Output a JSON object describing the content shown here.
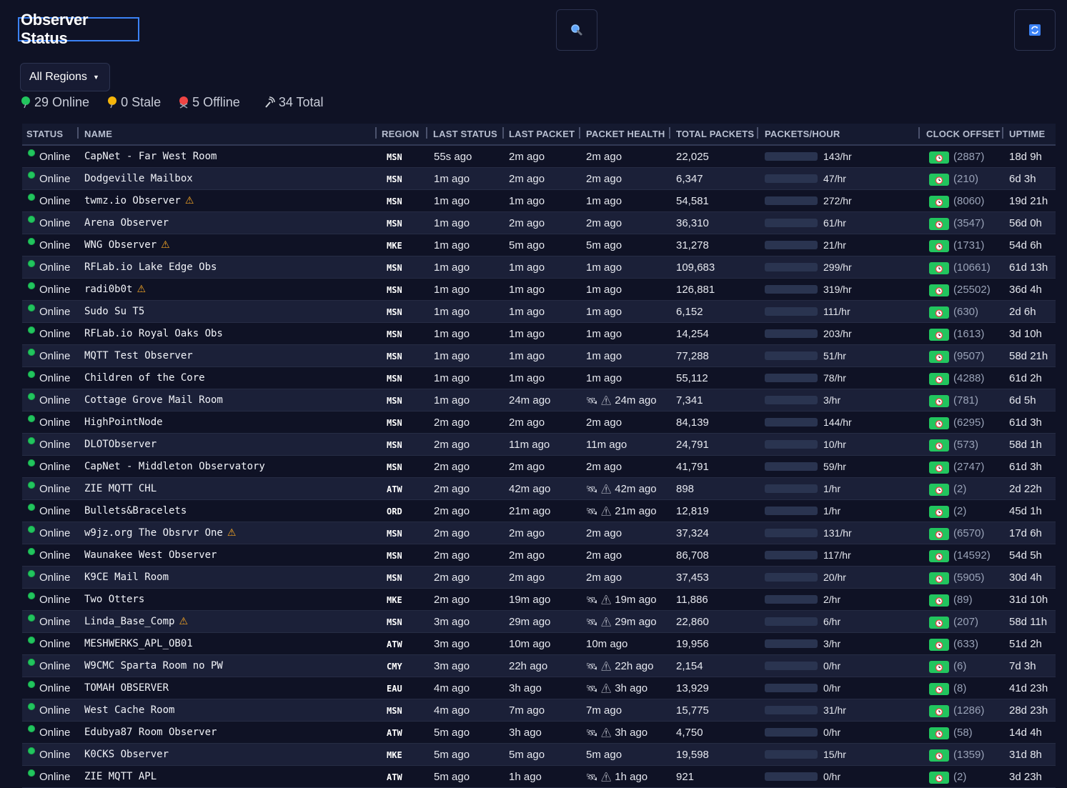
{
  "page": {
    "title": "Observer Status"
  },
  "region_filter": {
    "label": "All Regions"
  },
  "summary": {
    "online": "29 Online",
    "stale": "0 Stale",
    "offline": "5 Offline",
    "total": "34 Total"
  },
  "columns": [
    "STATUS",
    "NAME",
    "REGION",
    "LAST STATUS",
    "LAST PACKET",
    "PACKET HEALTH",
    "TOTAL PACKETS",
    "PACKETS/HOUR",
    "CLOCK OFFSET",
    "UPTIME"
  ],
  "colors": {
    "online": "#22c55e",
    "bar": "#4a8cf7",
    "warning": "#f5a524"
  },
  "rows": [
    {
      "status": "Online",
      "name": "CapNet - Far West Room",
      "warn": false,
      "region": "MSN",
      "last_status": "55s ago",
      "last_packet": "2m ago",
      "health": "2m ago",
      "health_warn": false,
      "total": "22,025",
      "pph": "143/hr",
      "pph_fraction": 0.45,
      "offset": "(2887)",
      "uptime": "18d 9h"
    },
    {
      "status": "Online",
      "name": "Dodgeville Mailbox",
      "warn": false,
      "region": "MSN",
      "last_status": "1m ago",
      "last_packet": "2m ago",
      "health": "2m ago",
      "health_warn": false,
      "total": "6,347",
      "pph": "47/hr",
      "pph_fraction": 0.15,
      "offset": "(210)",
      "uptime": "6d 3h"
    },
    {
      "status": "Online",
      "name": "twmz.io Observer",
      "warn": true,
      "region": "MSN",
      "last_status": "1m ago",
      "last_packet": "1m ago",
      "health": "1m ago",
      "health_warn": false,
      "total": "54,581",
      "pph": "272/hr",
      "pph_fraction": 0.85,
      "offset": "(8060)",
      "uptime": "19d 21h"
    },
    {
      "status": "Online",
      "name": "Arena Observer",
      "warn": false,
      "region": "MSN",
      "last_status": "1m ago",
      "last_packet": "2m ago",
      "health": "2m ago",
      "health_warn": false,
      "total": "36,310",
      "pph": "61/hr",
      "pph_fraction": 0.19,
      "offset": "(3547)",
      "uptime": "56d 0h"
    },
    {
      "status": "Online",
      "name": "WNG Observer",
      "warn": true,
      "region": "MKE",
      "last_status": "1m ago",
      "last_packet": "5m ago",
      "health": "5m ago",
      "health_warn": false,
      "total": "31,278",
      "pph": "21/hr",
      "pph_fraction": 0.07,
      "offset": "(1731)",
      "uptime": "54d 6h"
    },
    {
      "status": "Online",
      "name": "RFLab.io Lake Edge Obs",
      "warn": false,
      "region": "MSN",
      "last_status": "1m ago",
      "last_packet": "1m ago",
      "health": "1m ago",
      "health_warn": false,
      "total": "109,683",
      "pph": "299/hr",
      "pph_fraction": 0.94,
      "offset": "(10661)",
      "uptime": "61d 13h"
    },
    {
      "status": "Online",
      "name": "radi0b0t",
      "warn": true,
      "region": "MSN",
      "last_status": "1m ago",
      "last_packet": "1m ago",
      "health": "1m ago",
      "health_warn": false,
      "total": "126,881",
      "pph": "319/hr",
      "pph_fraction": 1.0,
      "offset": "(25502)",
      "uptime": "36d 4h"
    },
    {
      "status": "Online",
      "name": "Sudo Su T5",
      "warn": false,
      "region": "MSN",
      "last_status": "1m ago",
      "last_packet": "1m ago",
      "health": "1m ago",
      "health_warn": false,
      "total": "6,152",
      "pph": "111/hr",
      "pph_fraction": 0.35,
      "offset": "(630)",
      "uptime": "2d 6h"
    },
    {
      "status": "Online",
      "name": "RFLab.io Royal Oaks Obs",
      "warn": false,
      "region": "MSN",
      "last_status": "1m ago",
      "last_packet": "1m ago",
      "health": "1m ago",
      "health_warn": false,
      "total": "14,254",
      "pph": "203/hr",
      "pph_fraction": 0.64,
      "offset": "(1613)",
      "uptime": "3d 10h"
    },
    {
      "status": "Online",
      "name": "MQTT Test Observer",
      "warn": false,
      "region": "MSN",
      "last_status": "1m ago",
      "last_packet": "1m ago",
      "health": "1m ago",
      "health_warn": false,
      "total": "77,288",
      "pph": "51/hr",
      "pph_fraction": 0.16,
      "offset": "(9507)",
      "uptime": "58d 21h"
    },
    {
      "status": "Online",
      "name": "Children of the Core",
      "warn": false,
      "region": "MSN",
      "last_status": "1m ago",
      "last_packet": "1m ago",
      "health": "1m ago",
      "health_warn": false,
      "total": "55,112",
      "pph": "78/hr",
      "pph_fraction": 0.24,
      "offset": "(4288)",
      "uptime": "61d 2h"
    },
    {
      "status": "Online",
      "name": "Cottage Grove Mail Room",
      "warn": false,
      "region": "MSN",
      "last_status": "1m ago",
      "last_packet": "24m ago",
      "health": "24m ago",
      "health_warn": true,
      "total": "7,341",
      "pph": "3/hr",
      "pph_fraction": 0.01,
      "offset": "(781)",
      "uptime": "6d 5h"
    },
    {
      "status": "Online",
      "name": "HighPointNode",
      "warn": false,
      "region": "MSN",
      "last_status": "2m ago",
      "last_packet": "2m ago",
      "health": "2m ago",
      "health_warn": false,
      "total": "84,139",
      "pph": "144/hr",
      "pph_fraction": 0.45,
      "offset": "(6295)",
      "uptime": "61d 3h"
    },
    {
      "status": "Online",
      "name": "DLOTObserver",
      "warn": false,
      "region": "MSN",
      "last_status": "2m ago",
      "last_packet": "11m ago",
      "health": "11m ago",
      "health_warn": false,
      "total": "24,791",
      "pph": "10/hr",
      "pph_fraction": 0.03,
      "offset": "(573)",
      "uptime": "58d 1h"
    },
    {
      "status": "Online",
      "name": "CapNet - Middleton Observatory",
      "warn": false,
      "region": "MSN",
      "last_status": "2m ago",
      "last_packet": "2m ago",
      "health": "2m ago",
      "health_warn": false,
      "total": "41,791",
      "pph": "59/hr",
      "pph_fraction": 0.18,
      "offset": "(2747)",
      "uptime": "61d 3h"
    },
    {
      "status": "Online",
      "name": "ZIE MQTT CHL",
      "warn": false,
      "region": "ATW",
      "last_status": "2m ago",
      "last_packet": "42m ago",
      "health": "42m ago",
      "health_warn": true,
      "total": "898",
      "pph": "1/hr",
      "pph_fraction": 0.0,
      "offset": "(2)",
      "uptime": "2d 22h"
    },
    {
      "status": "Online",
      "name": "Bullets&Bracelets",
      "warn": false,
      "region": "ORD",
      "last_status": "2m ago",
      "last_packet": "21m ago",
      "health": "21m ago",
      "health_warn": true,
      "total": "12,819",
      "pph": "1/hr",
      "pph_fraction": 0.0,
      "offset": "(2)",
      "uptime": "45d 1h"
    },
    {
      "status": "Online",
      "name": "w9jz.org The Obsrvr One",
      "warn": true,
      "region": "MSN",
      "last_status": "2m ago",
      "last_packet": "2m ago",
      "health": "2m ago",
      "health_warn": false,
      "total": "37,324",
      "pph": "131/hr",
      "pph_fraction": 0.41,
      "offset": "(6570)",
      "uptime": "17d 6h"
    },
    {
      "status": "Online",
      "name": "Waunakee West Observer",
      "warn": false,
      "region": "MSN",
      "last_status": "2m ago",
      "last_packet": "2m ago",
      "health": "2m ago",
      "health_warn": false,
      "total": "86,708",
      "pph": "117/hr",
      "pph_fraction": 0.37,
      "offset": "(14592)",
      "uptime": "54d 5h"
    },
    {
      "status": "Online",
      "name": "K9CE Mail Room",
      "warn": false,
      "region": "MSN",
      "last_status": "2m ago",
      "last_packet": "2m ago",
      "health": "2m ago",
      "health_warn": false,
      "total": "37,453",
      "pph": "20/hr",
      "pph_fraction": 0.06,
      "offset": "(5905)",
      "uptime": "30d 4h"
    },
    {
      "status": "Online",
      "name": "Two Otters",
      "warn": false,
      "region": "MKE",
      "last_status": "2m ago",
      "last_packet": "19m ago",
      "health": "19m ago",
      "health_warn": true,
      "total": "11,886",
      "pph": "2/hr",
      "pph_fraction": 0.01,
      "offset": "(89)",
      "uptime": "31d 10h"
    },
    {
      "status": "Online",
      "name": "Linda_Base_Comp",
      "warn": true,
      "region": "MSN",
      "last_status": "3m ago",
      "last_packet": "29m ago",
      "health": "29m ago",
      "health_warn": true,
      "total": "22,860",
      "pph": "6/hr",
      "pph_fraction": 0.02,
      "offset": "(207)",
      "uptime": "58d 11h"
    },
    {
      "status": "Online",
      "name": "MESHWERKS_APL_OB01",
      "warn": false,
      "region": "ATW",
      "last_status": "3m ago",
      "last_packet": "10m ago",
      "health": "10m ago",
      "health_warn": false,
      "total": "19,956",
      "pph": "3/hr",
      "pph_fraction": 0.01,
      "offset": "(633)",
      "uptime": "51d 2h"
    },
    {
      "status": "Online",
      "name": "W9CMC Sparta Room no PW",
      "warn": false,
      "region": "CMY",
      "last_status": "3m ago",
      "last_packet": "22h ago",
      "health": "22h ago",
      "health_warn": true,
      "total": "2,154",
      "pph": "0/hr",
      "pph_fraction": 0.0,
      "offset": "(6)",
      "uptime": "7d 3h"
    },
    {
      "status": "Online",
      "name": "TOMAH OBSERVER",
      "warn": false,
      "region": "EAU",
      "last_status": "4m ago",
      "last_packet": "3h ago",
      "health": "3h ago",
      "health_warn": true,
      "total": "13,929",
      "pph": "0/hr",
      "pph_fraction": 0.0,
      "offset": "(8)",
      "uptime": "41d 23h"
    },
    {
      "status": "Online",
      "name": "West Cache Room",
      "warn": false,
      "region": "MSN",
      "last_status": "4m ago",
      "last_packet": "7m ago",
      "health": "7m ago",
      "health_warn": false,
      "total": "15,775",
      "pph": "31/hr",
      "pph_fraction": 0.1,
      "offset": "(1286)",
      "uptime": "28d 23h"
    },
    {
      "status": "Online",
      "name": "Edubya87 Room Observer",
      "warn": false,
      "region": "ATW",
      "last_status": "5m ago",
      "last_packet": "3h ago",
      "health": "3h ago",
      "health_warn": true,
      "total": "4,750",
      "pph": "0/hr",
      "pph_fraction": 0.0,
      "offset": "(58)",
      "uptime": "14d 4h"
    },
    {
      "status": "Online",
      "name": "K0CKS Observer",
      "warn": false,
      "region": "MKE",
      "last_status": "5m ago",
      "last_packet": "5m ago",
      "health": "5m ago",
      "health_warn": false,
      "total": "19,598",
      "pph": "15/hr",
      "pph_fraction": 0.05,
      "offset": "(1359)",
      "uptime": "31d 8h"
    },
    {
      "status": "Online",
      "name": "ZIE MQTT APL",
      "warn": false,
      "region": "ATW",
      "last_status": "5m ago",
      "last_packet": "1h ago",
      "health": "1h ago",
      "health_warn": true,
      "total": "921",
      "pph": "0/hr",
      "pph_fraction": 0.0,
      "offset": "(2)",
      "uptime": "3d 23h"
    }
  ]
}
